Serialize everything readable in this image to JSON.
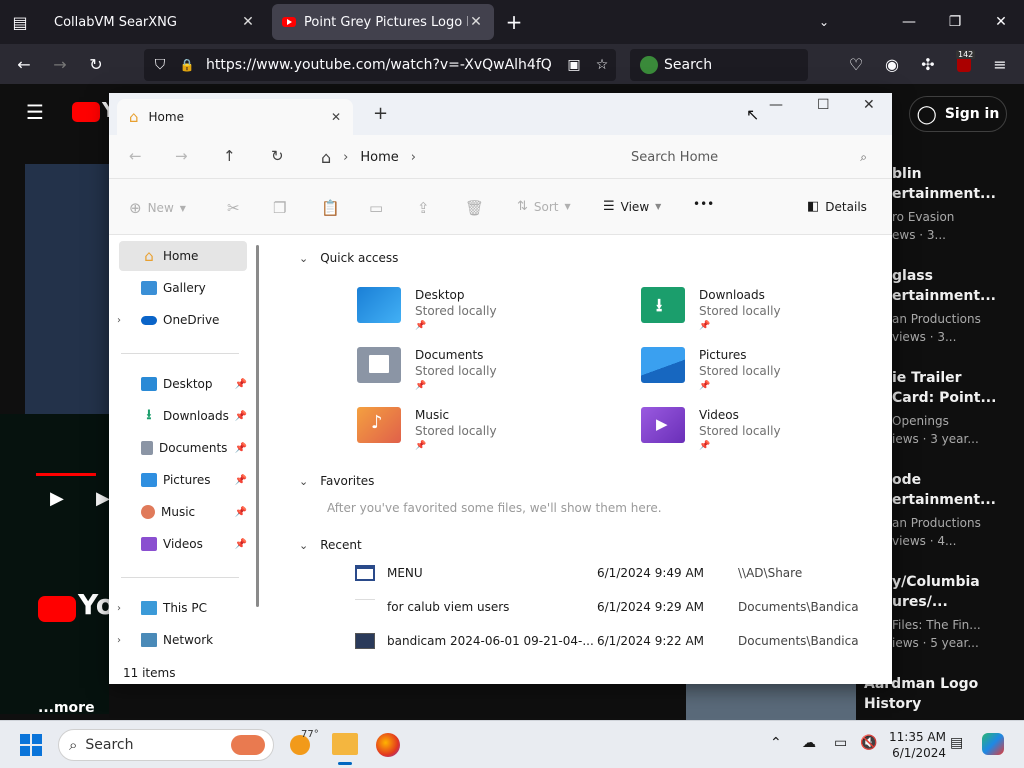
{
  "browser": {
    "tabs": [
      {
        "title": "CollabVM SearXNG"
      },
      {
        "title": "Point Grey Pictures Logo Histor"
      }
    ],
    "new_tab": "+",
    "url": "https://www.youtube.com/watch?v=-XvQwAlh4fQ",
    "search_placeholder": "Search",
    "badge": "142"
  },
  "youtube": {
    "sign_in": "Sign in",
    "more": "...more",
    "logo": "Yo",
    "logo_small": "Y",
    "cards": [
      {
        "t1": "blin",
        "t2": "ertainment...",
        "s1": "ro Evasion",
        "s2": "ews · 3..."
      },
      {
        "t1": "glass",
        "t2": "ertainment...",
        "s1": "an Productions",
        "s2": "views · 3..."
      },
      {
        "t1": "ie Trailer",
        "t2": "Card: Point...",
        "s1": "Openings",
        "s2": "iews · 3 year..."
      },
      {
        "t1": "ode",
        "t2": "ertainment...",
        "s1": "an Productions",
        "s2": "views · 4..."
      },
      {
        "t1": "y/Columbia",
        "t2": "ures/...",
        "s1": "Files: The Fin...",
        "s2": "iews · 5 year..."
      },
      {
        "t1": "Aardman Logo",
        "t2": "History",
        "s1": "",
        "s2": ""
      }
    ]
  },
  "explorer": {
    "tab_title": "Home",
    "breadcrumb": "Home",
    "search_placeholder": "Search Home",
    "toolbar": {
      "new": "New",
      "sort": "Sort",
      "view": "View",
      "more": "•••",
      "details": "Details"
    },
    "sidebar": {
      "top": [
        {
          "label": "Home"
        },
        {
          "label": "Gallery"
        },
        {
          "label": "OneDrive"
        }
      ],
      "pinned": [
        {
          "label": "Desktop"
        },
        {
          "label": "Downloads"
        },
        {
          "label": "Documents"
        },
        {
          "label": "Pictures"
        },
        {
          "label": "Music"
        },
        {
          "label": "Videos"
        }
      ],
      "bottom": [
        {
          "label": "This PC"
        },
        {
          "label": "Network"
        }
      ]
    },
    "sections": {
      "quick_access": "Quick access",
      "favorites": "Favorites",
      "favorites_hint": "After you've favorited some files, we'll show them here.",
      "recent": "Recent"
    },
    "quick_access": [
      {
        "name": "Desktop",
        "status": "Stored locally"
      },
      {
        "name": "Downloads",
        "status": "Stored locally"
      },
      {
        "name": "Documents",
        "status": "Stored locally"
      },
      {
        "name": "Pictures",
        "status": "Stored locally"
      },
      {
        "name": "Music",
        "status": "Stored locally"
      },
      {
        "name": "Videos",
        "status": "Stored locally"
      }
    ],
    "recent": [
      {
        "name": "MENU",
        "date": "6/1/2024 9:49 AM",
        "location": "\\\\AD\\Share"
      },
      {
        "name": "for calub viem users",
        "date": "6/1/2024 9:29 AM",
        "location": "Documents\\Bandica..."
      },
      {
        "name": "bandicam 2024-06-01 09-21-04-...",
        "date": "6/1/2024 9:22 AM",
        "location": "Documents\\Bandica..."
      }
    ],
    "status": "11 items"
  },
  "taskbar": {
    "search": "Search",
    "weather": "77°",
    "time": "11:35 AM",
    "date": "6/1/2024"
  },
  "colors": {
    "accent": "#0067c0",
    "yt_red": "#ff0000",
    "folder_yellow": "#f4b63f"
  }
}
